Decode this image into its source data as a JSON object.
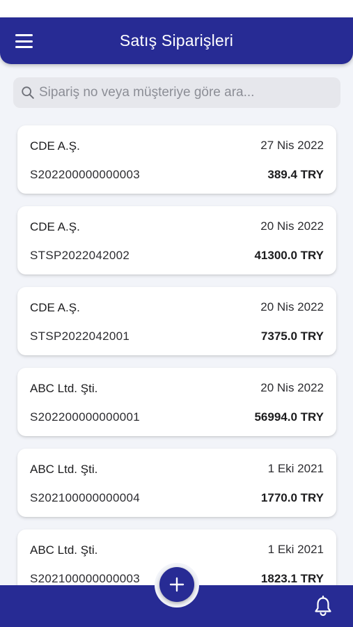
{
  "header": {
    "title": "Satış Siparişleri",
    "menu_icon": "hamburger-menu-icon"
  },
  "search": {
    "placeholder": "Sipariş no veya müşteriye göre ara...",
    "value": "",
    "icon": "search-icon"
  },
  "orders": [
    {
      "customer": "CDE A.Ş.",
      "date": "27 Nis 2022",
      "number": "S202200000000003",
      "amount": "389.4 TRY"
    },
    {
      "customer": "CDE A.Ş.",
      "date": "20 Nis 2022",
      "number": "STSP2022042002",
      "amount": "41300.0 TRY"
    },
    {
      "customer": "CDE A.Ş.",
      "date": "20 Nis 2022",
      "number": "STSP2022042001",
      "amount": "7375.0 TRY"
    },
    {
      "customer": "ABC Ltd. Şti.",
      "date": "20 Nis 2022",
      "number": "S202200000000001",
      "amount": "56994.0 TRY"
    },
    {
      "customer": "ABC Ltd. Şti.",
      "date": "1 Eki 2021",
      "number": "S202100000000004",
      "amount": "1770.0 TRY"
    },
    {
      "customer": "ABC Ltd. Şti.",
      "date": "1 Eki 2021",
      "number": "S202100000000003",
      "amount": "1823.1 TRY"
    }
  ],
  "bottom_bar": {
    "fab_icon": "plus-icon",
    "notification_icon": "bell-icon"
  },
  "colors": {
    "primary": "#272b94",
    "background": "#f2f4f9",
    "search_background": "#e6e7ec"
  }
}
